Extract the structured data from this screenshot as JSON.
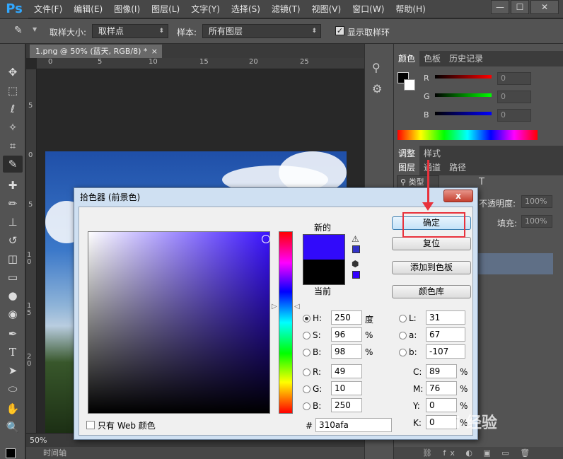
{
  "app": {
    "logo": "Ps"
  },
  "menu": [
    "文件(F)",
    "编辑(E)",
    "图像(I)",
    "图层(L)",
    "文字(Y)",
    "选择(S)",
    "滤镜(T)",
    "视图(V)",
    "窗口(W)",
    "帮助(H)"
  ],
  "window_controls": {
    "minimize": "—",
    "maximize": "☐",
    "close": "✕"
  },
  "options": {
    "sample_size_label": "取样大小:",
    "sample_size_value": "取样点",
    "sample_label": "样本:",
    "sample_value": "所有图层",
    "show_ring_label": "显示取样环",
    "show_ring_checked": true
  },
  "document": {
    "tab_title": "1.png @ 50% (蓝天, RGB/8) *",
    "tab_close": "×",
    "ruler_top": [
      "0",
      "5",
      "10",
      "15",
      "20",
      "25"
    ],
    "ruler_left": [
      "5",
      "0",
      "5",
      "1 0",
      "1 5",
      "2 0"
    ],
    "zoom": "50%",
    "timeline_label": "时间轴"
  },
  "panels": {
    "color_tabs": [
      "颜色",
      "色板",
      "历史记录"
    ],
    "channels": [
      {
        "label": "R",
        "value": "0"
      },
      {
        "label": "G",
        "value": "0"
      },
      {
        "label": "B",
        "value": "0"
      }
    ],
    "adjust_tabs": [
      "调整",
      "样式"
    ],
    "layer_tabs": [
      "图层",
      "通道",
      "路径"
    ],
    "layer_filter": "类型",
    "opacity_label": "不透明度:",
    "opacity_value": "100%",
    "fill_label": "填充:",
    "fill_value": "100%"
  },
  "dialog": {
    "title": "拾色器 (前景色)",
    "close": "x",
    "new_label": "新的",
    "current_label": "当前",
    "new_color": "#310afa",
    "current_color": "#000000",
    "buttons": {
      "ok": "确定",
      "reset": "复位",
      "add_swatch": "添加到色板",
      "libraries": "颜色库"
    },
    "hsb": [
      {
        "label": "H:",
        "value": "250",
        "unit": "度",
        "selected": true
      },
      {
        "label": "S:",
        "value": "96",
        "unit": "%",
        "selected": false
      },
      {
        "label": "B:",
        "value": "98",
        "unit": "%",
        "selected": false
      }
    ],
    "rgb": [
      {
        "label": "R:",
        "value": "49"
      },
      {
        "label": "G:",
        "value": "10"
      },
      {
        "label": "B:",
        "value": "250"
      }
    ],
    "lab": [
      {
        "label": "L:",
        "value": "31"
      },
      {
        "label": "a:",
        "value": "67"
      },
      {
        "label": "b:",
        "value": "-107"
      }
    ],
    "cmyk": [
      {
        "label": "C:",
        "value": "89",
        "unit": "%"
      },
      {
        "label": "M:",
        "value": "76",
        "unit": "%"
      },
      {
        "label": "Y:",
        "value": "0",
        "unit": "%"
      },
      {
        "label": "K:",
        "value": "0",
        "unit": "%"
      }
    ],
    "hex_label": "#",
    "hex_value": "310afa",
    "web_only_label": "只有 Web 颜色",
    "web_only_checked": false
  },
  "watermark": "Bai 经验",
  "colors": {
    "annotation": "#e8323c",
    "accent": "#31a8ff"
  }
}
